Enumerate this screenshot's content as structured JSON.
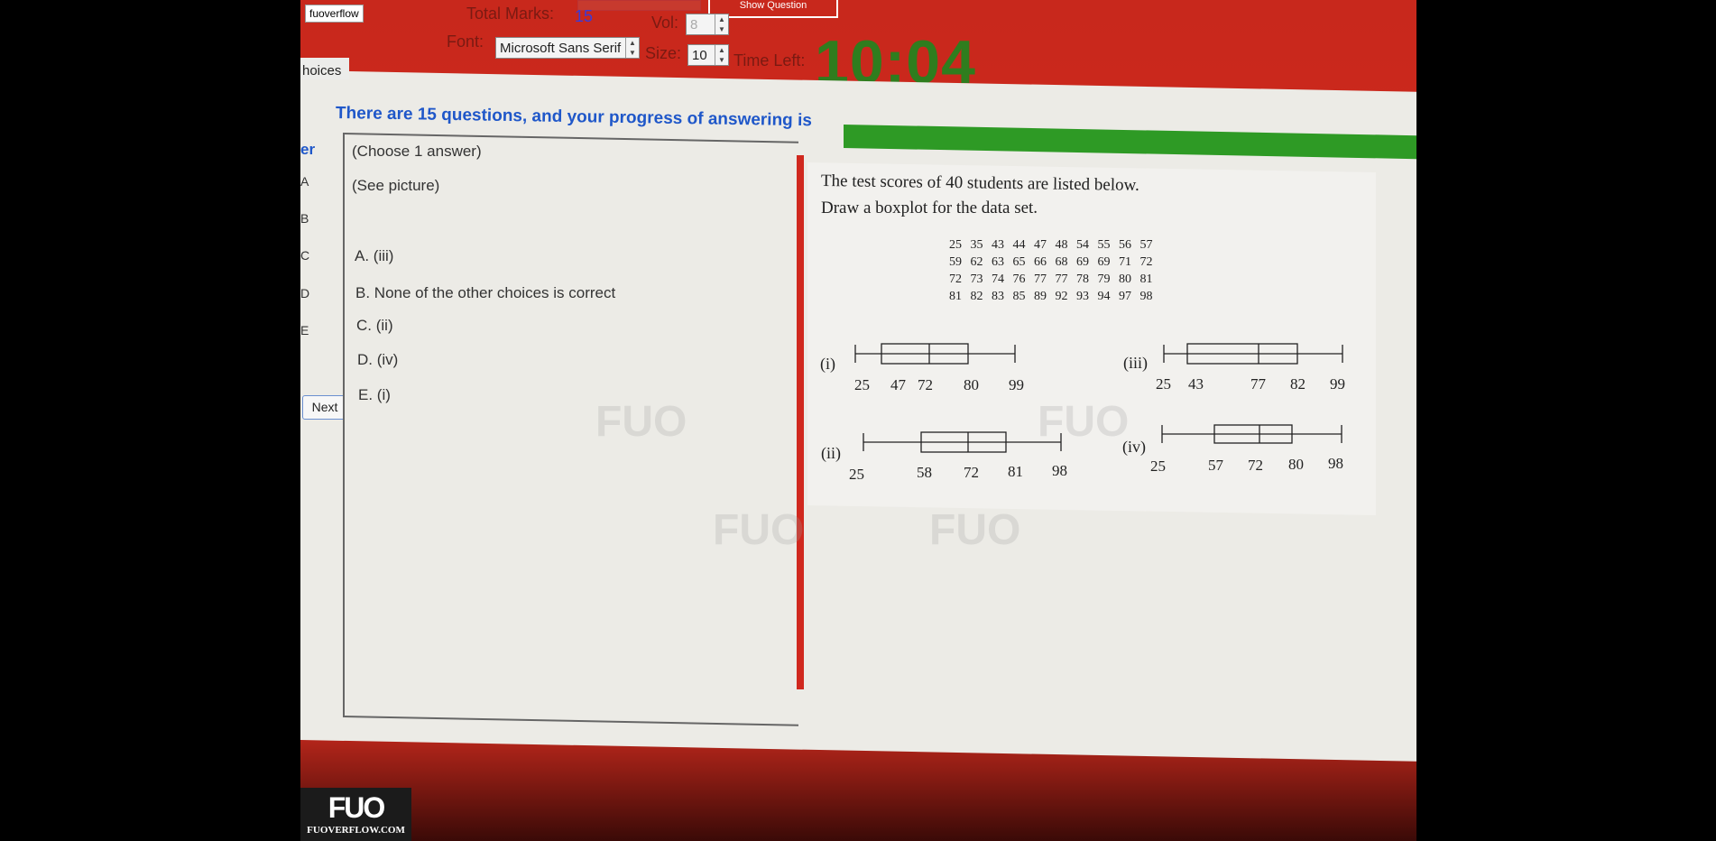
{
  "watermark_tag": "fuoverflow",
  "header": {
    "total_marks_label": "Total Marks:",
    "total_marks_value": "15",
    "vol_label": "Vol:",
    "vol_value": "8",
    "font_label": "Font:",
    "font_value": "Microsoft Sans Serif",
    "size_label": "Size:",
    "size_value": "10",
    "time_left_label": "Time Left:",
    "time_left_value": "10:04",
    "show_question_label": "Show Question"
  },
  "tab_label": "hoices",
  "progress_text": "There are 15 questions, and your progress of answering is",
  "progress_fraction": 1.0,
  "sidebar": {
    "header": "er",
    "letters": [
      "A",
      "B",
      "C",
      "D",
      "E"
    ],
    "next_label": "Next"
  },
  "answer_panel": {
    "instruction": "(Choose 1 answer)",
    "see_picture": "(See picture)",
    "options": [
      {
        "letter": "A.",
        "text": "(iii)"
      },
      {
        "letter": "B.",
        "text": "None of the other choices is correct"
      },
      {
        "letter": "C.",
        "text": "(ii)"
      },
      {
        "letter": "D.",
        "text": "(iv)"
      },
      {
        "letter": "E.",
        "text": "(i)"
      }
    ]
  },
  "question": {
    "line1": "The test scores of 40 students are listed below.",
    "line2": "Draw a boxplot for the data set.",
    "data_rows": [
      "25 35 43 44 47 48 54 55 56 57",
      "59 62 63 65 66 68 69 69 71 72",
      "72 73 74 76 77 77 78 79 80 81",
      "81 82 83 85 89 92 93 94 97 98"
    ],
    "boxplots": [
      {
        "label": "(i)",
        "ticks": [
          "25",
          "47",
          "72",
          "80",
          "99"
        ]
      },
      {
        "label": "(iii)",
        "ticks": [
          "25",
          "43",
          "77",
          "82",
          "99"
        ]
      },
      {
        "label": "(ii)",
        "ticks": [
          "25",
          "58",
          "72",
          "81",
          "98"
        ]
      },
      {
        "label": "(iv)",
        "ticks": [
          "25",
          "57",
          "72",
          "80",
          "98"
        ]
      }
    ]
  },
  "logo": {
    "mark": "FUO",
    "site": "FUOVERFLOW.COM"
  }
}
